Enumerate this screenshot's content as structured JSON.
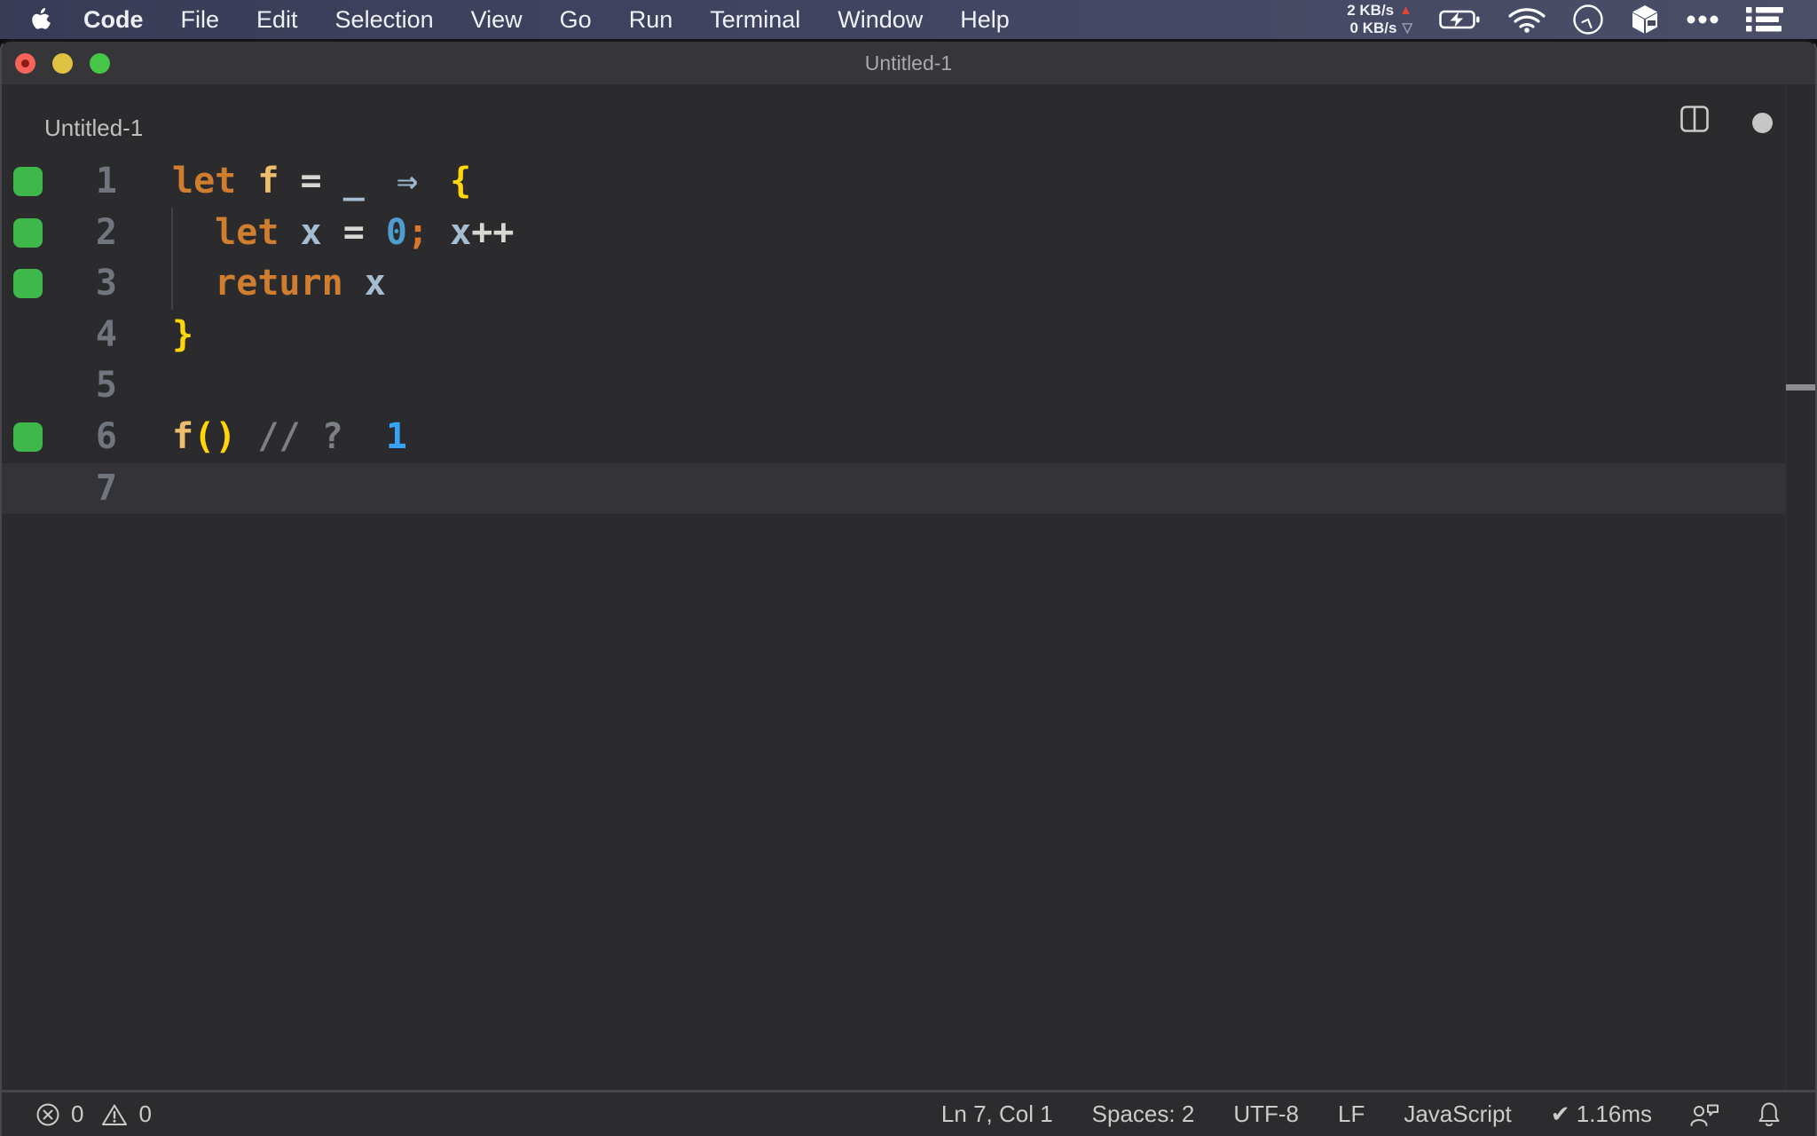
{
  "menu_bar": {
    "app_name": "Code",
    "items": [
      "File",
      "Edit",
      "Selection",
      "View",
      "Go",
      "Run",
      "Terminal",
      "Window",
      "Help"
    ],
    "network": {
      "up": "2 KB/s",
      "down": "0 KB/s",
      "up_arrow": "▲",
      "down_arrow": "▽"
    },
    "icons": [
      "apple-logo",
      "battery-charging-icon",
      "wifi-icon",
      "clock-icon",
      "cube-icon",
      "ellipsis-icon",
      "list-icon"
    ]
  },
  "window": {
    "title": "Untitled-1"
  },
  "tab_bar": {
    "tab_label": "Untitled-1"
  },
  "editor": {
    "language": "JavaScript",
    "lines": [
      {
        "num": 1,
        "covered": true,
        "current": false,
        "tokens": [
          [
            "kw",
            "let"
          ],
          [
            "plain",
            " "
          ],
          [
            "fn",
            "f"
          ],
          [
            "plain",
            " "
          ],
          [
            "op",
            "="
          ],
          [
            "plain",
            " "
          ],
          [
            "var",
            "_"
          ],
          [
            "plain",
            " "
          ],
          [
            "arrow",
            "⇒"
          ],
          [
            "plain",
            " "
          ],
          [
            "brace",
            "{"
          ]
        ]
      },
      {
        "num": 2,
        "covered": true,
        "current": false,
        "tokens": [
          [
            "plain",
            "  "
          ],
          [
            "kw",
            "let"
          ],
          [
            "plain",
            " "
          ],
          [
            "var",
            "x"
          ],
          [
            "plain",
            " "
          ],
          [
            "op",
            "="
          ],
          [
            "plain",
            " "
          ],
          [
            "num",
            "0"
          ],
          [
            "semi",
            ";"
          ],
          [
            "plain",
            " "
          ],
          [
            "var",
            "x"
          ],
          [
            "op",
            "++"
          ]
        ]
      },
      {
        "num": 3,
        "covered": true,
        "current": false,
        "tokens": [
          [
            "plain",
            "  "
          ],
          [
            "kw",
            "return"
          ],
          [
            "plain",
            " "
          ],
          [
            "var",
            "x"
          ]
        ]
      },
      {
        "num": 4,
        "covered": false,
        "current": false,
        "tokens": [
          [
            "brace",
            "}"
          ]
        ]
      },
      {
        "num": 5,
        "covered": false,
        "current": false,
        "tokens": []
      },
      {
        "num": 6,
        "covered": true,
        "current": false,
        "tokens": [
          [
            "fn",
            "f"
          ],
          [
            "brace",
            "("
          ],
          [
            "brace",
            ")"
          ],
          [
            "plain",
            " "
          ],
          [
            "comment",
            "// ?"
          ],
          [
            "plain",
            "  "
          ],
          [
            "value",
            "1"
          ]
        ]
      },
      {
        "num": 7,
        "covered": false,
        "current": true,
        "tokens": []
      }
    ]
  },
  "status_bar": {
    "error_count": "0",
    "warning_count": "0",
    "items": [
      {
        "name": "cursor-position",
        "label": "Ln 7, Col 1"
      },
      {
        "name": "indentation",
        "label": "Spaces: 2"
      },
      {
        "name": "encoding",
        "label": "UTF-8"
      },
      {
        "name": "eol-sequence",
        "label": "LF"
      },
      {
        "name": "language-mode",
        "label": "JavaScript"
      },
      {
        "name": "quokka-status",
        "label": "✔ 1.16ms"
      }
    ]
  },
  "colors": {
    "accent-keyword": "#cf7d2e",
    "accent-function": "#edbd6b",
    "accent-operator": "#d8d8d2",
    "accent-variable": "#a6bcd2",
    "accent-arrow": "#9fb6cf",
    "accent-brace": "#ffd60a",
    "accent-number": "#4f9cce",
    "accent-semicolon": "#d9772c",
    "accent-comment": "#7c8086",
    "accent-value": "#36a3f4",
    "coverage-green": "#3fb84b",
    "net-up-red": "#e2453d"
  }
}
